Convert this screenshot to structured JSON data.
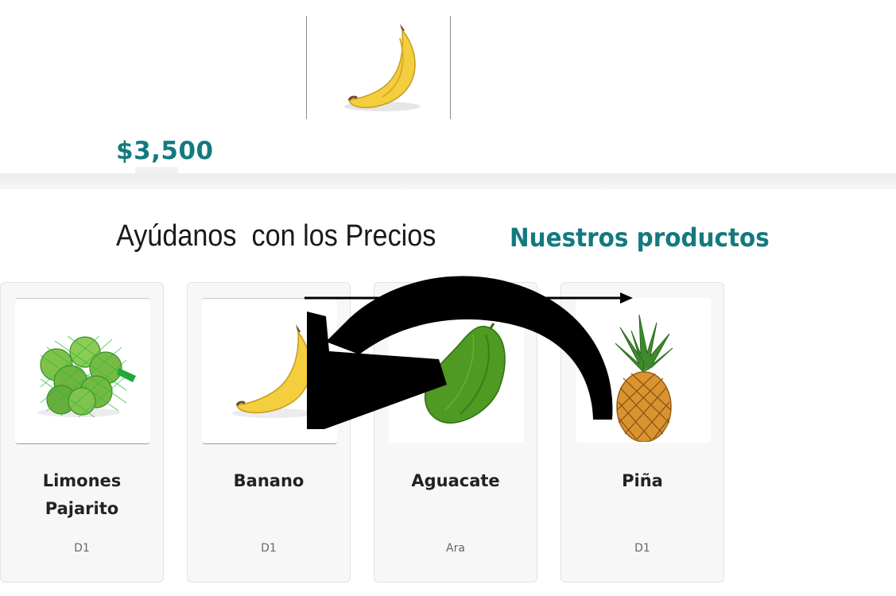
{
  "hero": {
    "image_name": "banana",
    "price": "$3,500"
  },
  "section": {
    "help_heading": "Ayúdanos  con los Precios",
    "products_heading": "Nuestros productos"
  },
  "products": [
    {
      "name": "Limones Pajarito",
      "store": "D1",
      "image": "limes-in-mesh-bag"
    },
    {
      "name": "Banano",
      "store": "D1",
      "image": "banana"
    },
    {
      "name": "Aguacate",
      "store": "Ara",
      "image": "green-papaya-avocado"
    },
    {
      "name": "Piña",
      "store": "D1",
      "image": "pineapple"
    }
  ],
  "colors": {
    "accent": "#137a7f",
    "card_bg": "#f7f7f7",
    "annotation": "#000000"
  }
}
